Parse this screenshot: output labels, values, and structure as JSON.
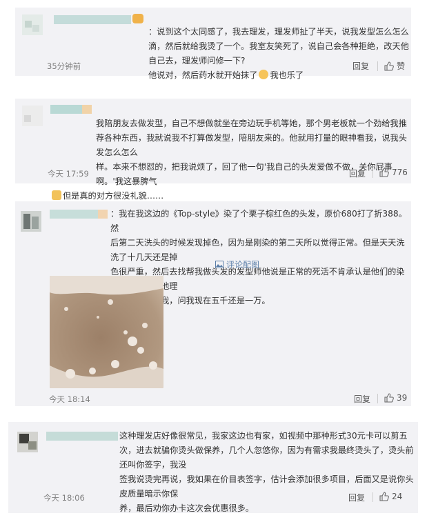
{
  "colors": {
    "card_bg": "#f2f2f5",
    "text": "#333333",
    "meta": "#808080",
    "link": "#5a7ea8",
    "name_blur": "#bdd9d6"
  },
  "comments": [
    {
      "text_before_emoji": "：说到这个太同感了，我去理发，理发师扯了半天，说我发型怎么怎么\n滴，然后就给我烫了一个。我室友笑死了，说自己会各种拒绝，改天他自己去，理发师问修一下?\n他说对，然后药水就开始抹了",
      "text_after_emoji": "我也乐了",
      "time": "35分钟前",
      "reply": "回复",
      "like": "赞"
    },
    {
      "text_line1": "我陪朋友去做发型，自己不想做就坐在旁边玩手机等她，那个男老板就一个劲给我推\n荐各种东西，我就说我不打算做发型，陪朋友来的。他就用打量的眼神看我，说我头发怎么怎么\n样。本来不想怼的，把我说烦了，回了他一句'我自己的头发爱做不做，关你屁事啊。'我这暴脾气",
      "text_line2": "但是真的对方很没礼貌……",
      "time": "今天 17:59",
      "reply": "回复",
      "like": "776"
    },
    {
      "text": "：我在我这边的《Top-style》染了个栗子棕红色的头发，原价680打了折388。然\n后第二天洗头的时候发现掉色，因为是刚染的第二天所以觉得正常。但是天天洗洗了十几天还是掉\n色很严重，然后去找帮我做头发的发型师他说是正常的死活不肯承认是他们的染发剂不好。找他理\n赔的时候还凶我，问我现在五千还是一万。",
      "photo_link": "评论配图",
      "time": "今天 18:14",
      "reply": "回复",
      "like": "39"
    },
    {
      "text": "这种理发店好像很常见，我家这边也有家，如视频中那种形式30元卡可以剪五\n次，进去就骗你烫头做保养，几个人忽悠你，因为有需求我最终烫头了，烫头前还叫你签字，我没\n签我说烫完再说，我如果在价目表签字，估计会添加很多项目，后面又是说你头皮质量暗示你保\n养，最后劝你办卡这次会优惠很多。",
      "time": "今天 18:06",
      "reply": "回复",
      "like": "24"
    }
  ]
}
